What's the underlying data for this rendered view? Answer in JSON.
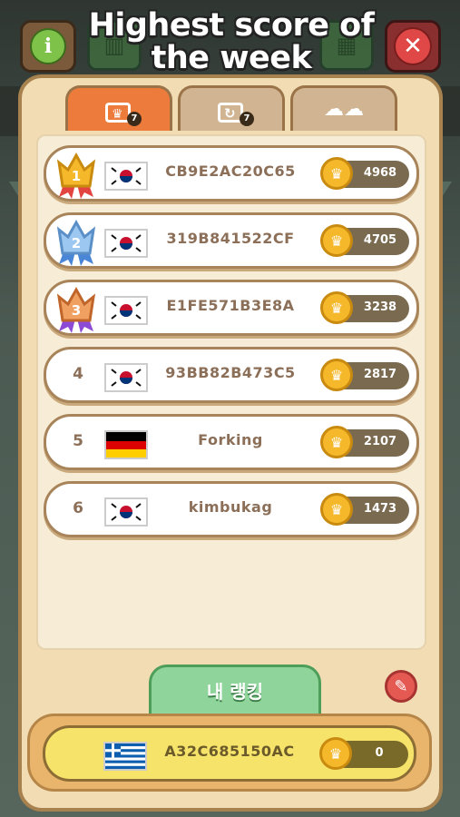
{
  "title": "Highest score of the week",
  "tabs": [
    {
      "name": "weekly-crown",
      "badge": "7",
      "active": true
    },
    {
      "name": "weekly-refresh",
      "badge": "7",
      "active": false
    },
    {
      "name": "clouds",
      "badge": "",
      "active": false
    }
  ],
  "leaderboard": [
    {
      "rank": "1",
      "country": "KR",
      "name": "CB9E2AC20C65",
      "score": "4968"
    },
    {
      "rank": "2",
      "country": "KR",
      "name": "319B841522CF",
      "score": "4705"
    },
    {
      "rank": "3",
      "country": "KR",
      "name": "E1FE571B3E8A",
      "score": "3238"
    },
    {
      "rank": "4",
      "country": "KR",
      "name": "93BB82B473C5",
      "score": "2817"
    },
    {
      "rank": "5",
      "country": "DE",
      "name": "Forking",
      "score": "2107"
    },
    {
      "rank": "6",
      "country": "KR",
      "name": "kimbukag",
      "score": "1473"
    }
  ],
  "my_ranking": {
    "tab_label": "내 랭킹",
    "country": "GR",
    "name": "A32C685150AC",
    "score": "0"
  },
  "colors": {
    "gold": "#f5b82a",
    "silver": "#7fb3e6",
    "bronze": "#e88a3a",
    "active_tab": "#ec7b3c",
    "my_tab": "#8fd49b"
  }
}
